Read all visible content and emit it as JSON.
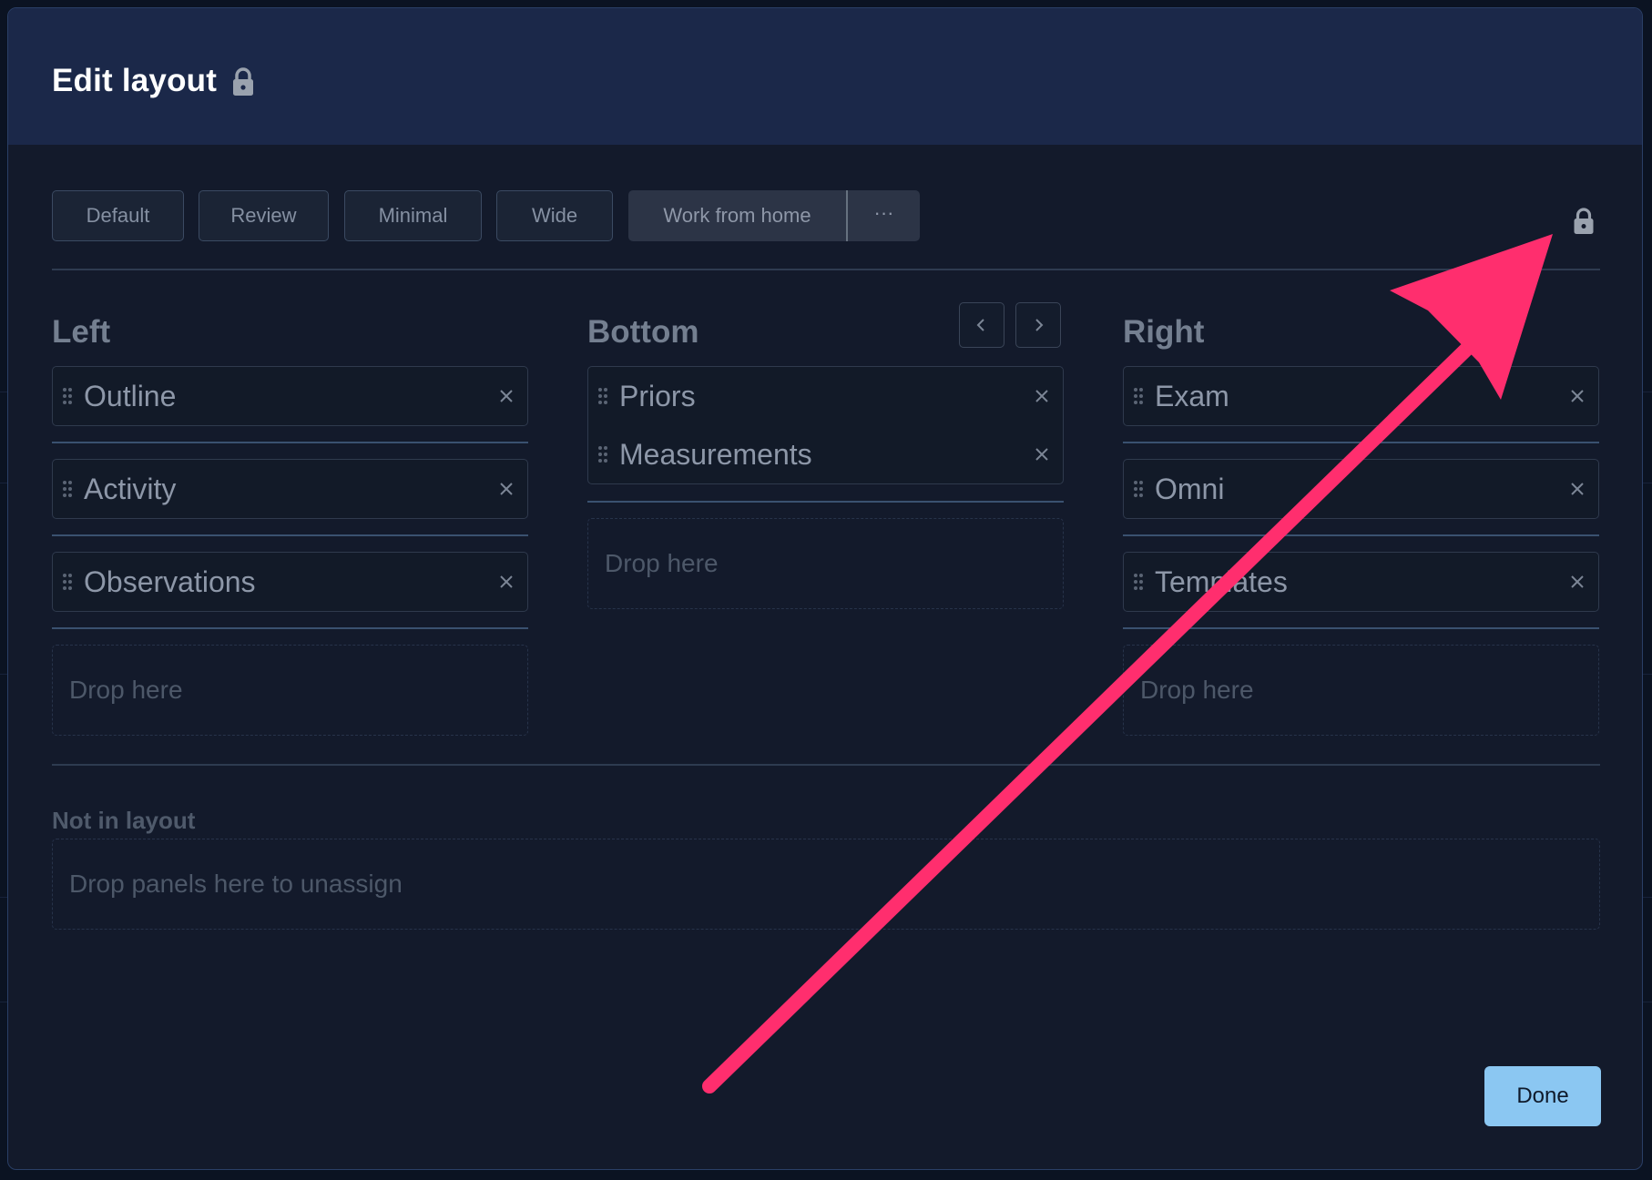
{
  "dialog": {
    "title": "Edit layout"
  },
  "presets": {
    "items": [
      "Default",
      "Review",
      "Minimal",
      "Wide"
    ],
    "active": "Work from home",
    "more": "···"
  },
  "columns": {
    "left": {
      "title": "Left",
      "panels": [
        "Outline",
        "Activity",
        "Observations"
      ],
      "drop": "Drop here"
    },
    "bottom": {
      "title": "Bottom",
      "panels": [
        "Priors",
        "Measurements"
      ],
      "drop": "Drop here"
    },
    "right": {
      "title": "Right",
      "panels": [
        "Exam",
        "Omni",
        "Templates"
      ],
      "drop": "Drop here"
    }
  },
  "not_in_layout": {
    "title": "Not in layout",
    "drop": "Drop panels here to unassign"
  },
  "footer": {
    "done_label": "Done"
  },
  "colors": {
    "accent_button": "#8bc7f2",
    "annotation_arrow": "#ff2e6e",
    "header_bg": "#1b2849",
    "dialog_bg": "#131a2b"
  },
  "icons": {
    "title_lock": "lock-icon",
    "top_right_lock": "lock-icon",
    "panel_grip": "drag-handle-icon",
    "panel_close": "close-icon",
    "prev": "chevron-left-icon",
    "next": "chevron-right-icon"
  }
}
